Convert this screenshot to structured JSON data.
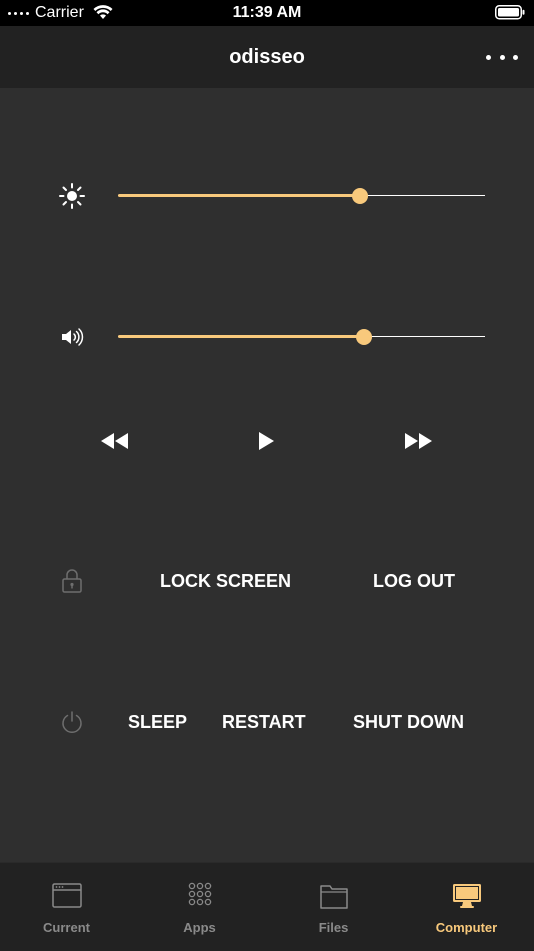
{
  "status_bar": {
    "carrier": "Carrier",
    "time": "11:39 AM"
  },
  "nav": {
    "title": "odisseo",
    "more_icon": "more-icon"
  },
  "brightness": {
    "icon": "brightness-icon",
    "level": 0.66
  },
  "volume": {
    "icon": "volume-icon",
    "level": 0.67
  },
  "media": {
    "rewind_icon": "rewind-icon",
    "play_icon": "play-icon",
    "fast_forward_icon": "fast-forward-icon"
  },
  "session": {
    "icon": "lock-icon",
    "lock_label": "LOCK SCREEN",
    "logout_label": "LOG OUT"
  },
  "power": {
    "icon": "power-icon",
    "sleep_label": "SLEEP",
    "restart_label": "RESTART",
    "shutdown_label": "SHUT DOWN"
  },
  "tabs": [
    {
      "label": "Current",
      "icon": "window-icon",
      "active": false
    },
    {
      "label": "Apps",
      "icon": "apps-grid-icon",
      "active": false
    },
    {
      "label": "Files",
      "icon": "folder-icon",
      "active": false
    },
    {
      "label": "Computer",
      "icon": "monitor-icon",
      "active": true
    }
  ],
  "colors": {
    "accent": "#f8c97c",
    "background": "#2f2f2f",
    "bar_background": "#222222",
    "inactive_tab": "#8a8a8a"
  }
}
